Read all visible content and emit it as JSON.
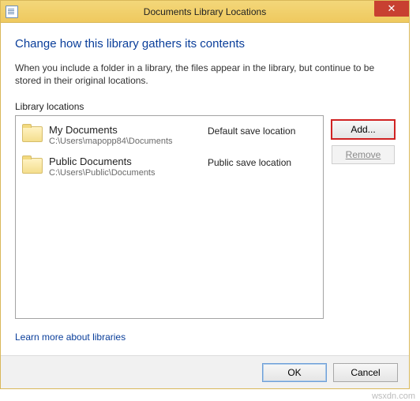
{
  "title": "Documents Library Locations",
  "heading": "Change how this library gathers its contents",
  "description": "When you include a folder in a library, the files appear in the library, but continue to be stored in their original locations.",
  "list_label": "Library locations",
  "items": [
    {
      "name": "My Documents",
      "path": "C:\\Users\\mapopp84\\Documents",
      "tag": "Default save location"
    },
    {
      "name": "Public Documents",
      "path": "C:\\Users\\Public\\Documents",
      "tag": "Public save location"
    }
  ],
  "buttons": {
    "add": "Add...",
    "remove": "Remove",
    "ok": "OK",
    "cancel": "Cancel"
  },
  "learn_more": "Learn more about libraries",
  "watermark": "wsxdn.com"
}
